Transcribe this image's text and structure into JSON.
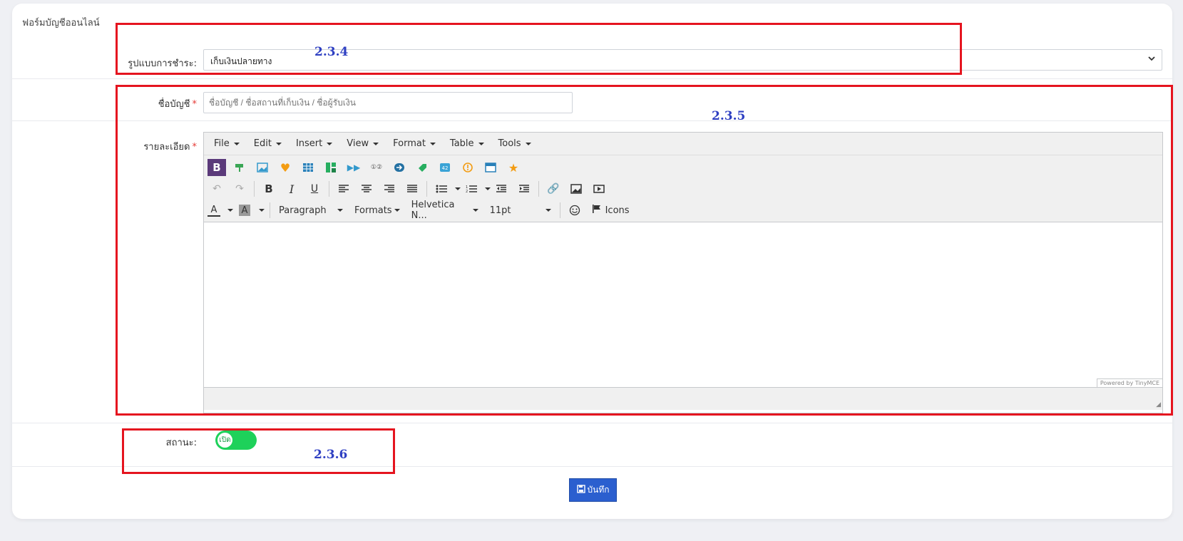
{
  "card": {
    "title": "ฟอร์มบัญชีออนไลน์"
  },
  "payment": {
    "label": "รูปแบบการชำระ:",
    "value": "เก็บเงินปลายทาง"
  },
  "account": {
    "label": "ชื่อบัญชี",
    "required": "*",
    "placeholder": "ชื่อบัญชี / ชื่อสถานที่เก็บเงิน / ชื่อผู้รับเงิน"
  },
  "detail": {
    "label": "รายละเอียด",
    "required": "*"
  },
  "editor": {
    "menus": [
      "File",
      "Edit",
      "Insert",
      "View",
      "Format",
      "Table",
      "Tools"
    ],
    "paragraph": "Paragraph",
    "formats": "Formats",
    "font": "Helvetica N...",
    "size": "11pt",
    "icons_label": "Icons",
    "powered": "Powered by TinyMCE",
    "bold_glyph": "B",
    "italic_glyph": "I",
    "underline_glyph": "U",
    "fontcolor_glyph": "A"
  },
  "status": {
    "label": "สถานะ:",
    "toggle_text": "เปิด",
    "on": true
  },
  "save": {
    "label": "บันทึก"
  },
  "annotations": {
    "a1": "2.3.4",
    "a2": "2.3.5",
    "a3": "2.3.6"
  },
  "colors": {
    "accent": "#2b5fcf",
    "toggle": "#1ed15a",
    "highlight": "#e5141f",
    "annotation": "#2e3fc2"
  }
}
